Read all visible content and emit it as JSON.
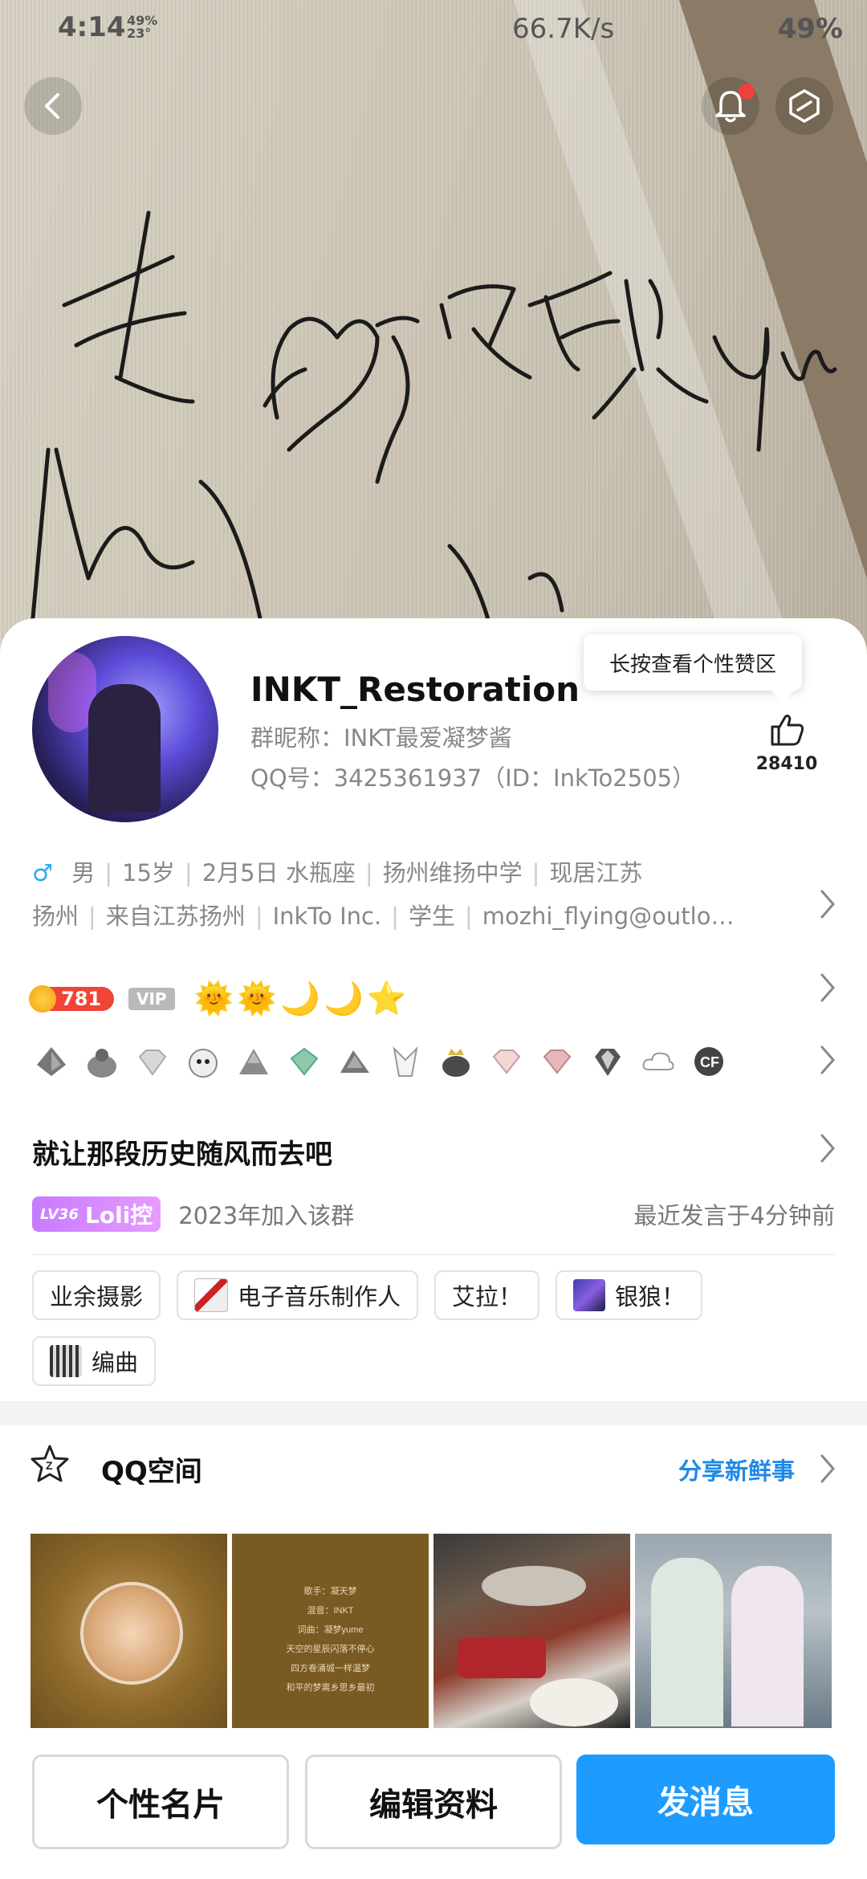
{
  "status_bar": {
    "time": "4:14",
    "small_top": "49%",
    "small_bottom": "23°",
    "speed": "66.7K/s",
    "battery": "49%"
  },
  "header": {
    "back_icon": "back-arrow-icon",
    "bell_icon": "bell-icon",
    "more_icon": "hexagon-slash-icon"
  },
  "cover": {
    "signature_text": "长 ♡ 凝梦yume"
  },
  "profile": {
    "name": "INKT_Restoration",
    "group_nickname": "群昵称：INKT最爱凝梦酱",
    "qq_number": "QQ号：3425361937（ID：InkTo2505）",
    "tooltip": "长按查看个性赞区",
    "likes": "28410"
  },
  "info": {
    "gender_icon": "♂",
    "line1": [
      "男",
      "15岁",
      "2月5日  水瓶座",
      "扬州维扬中学",
      "现居江苏"
    ],
    "line2": [
      "扬州",
      "来自江苏扬州",
      "InkTo  Inc.",
      "学生",
      "mozhi_flying@outlo…"
    ]
  },
  "level": {
    "coin": "781",
    "vip": "VIP",
    "suns": "🌞🌞🌙🌙⭐"
  },
  "badges": [
    "game-badge-1",
    "game-badge-2",
    "diamond-badge",
    "bomb-badge",
    "mountain-badge",
    "emerald-badge",
    "cap-badge",
    "tux-badge",
    "crown-badge",
    "pink-diamond-badge",
    "ruby-badge",
    "silver-diamond-badge",
    "cloud-badge",
    "cf-badge"
  ],
  "motto": "就让那段历史随风而去吧",
  "group_level": {
    "lv": "LV36",
    "title": "Loli控",
    "joined": "2023年加入该群",
    "last_speak": "最近发言于4分钟前"
  },
  "tags": [
    "业余摄影",
    "电子音乐制作人",
    "艾拉！",
    "银狼！",
    "编曲"
  ],
  "qzone": {
    "title": "QQ空间",
    "share": "分享新鲜事",
    "photo2_lines": [
      "歌手：凝天梦",
      "混音：INKT",
      "词曲：凝梦yume",
      "天空的星辰闪落不停心",
      "四方卷涌城一样温梦",
      "和平的梦离乡思乡最初"
    ]
  },
  "buttons": {
    "card": "个性名片",
    "edit": "编辑资料",
    "message": "发消息"
  }
}
